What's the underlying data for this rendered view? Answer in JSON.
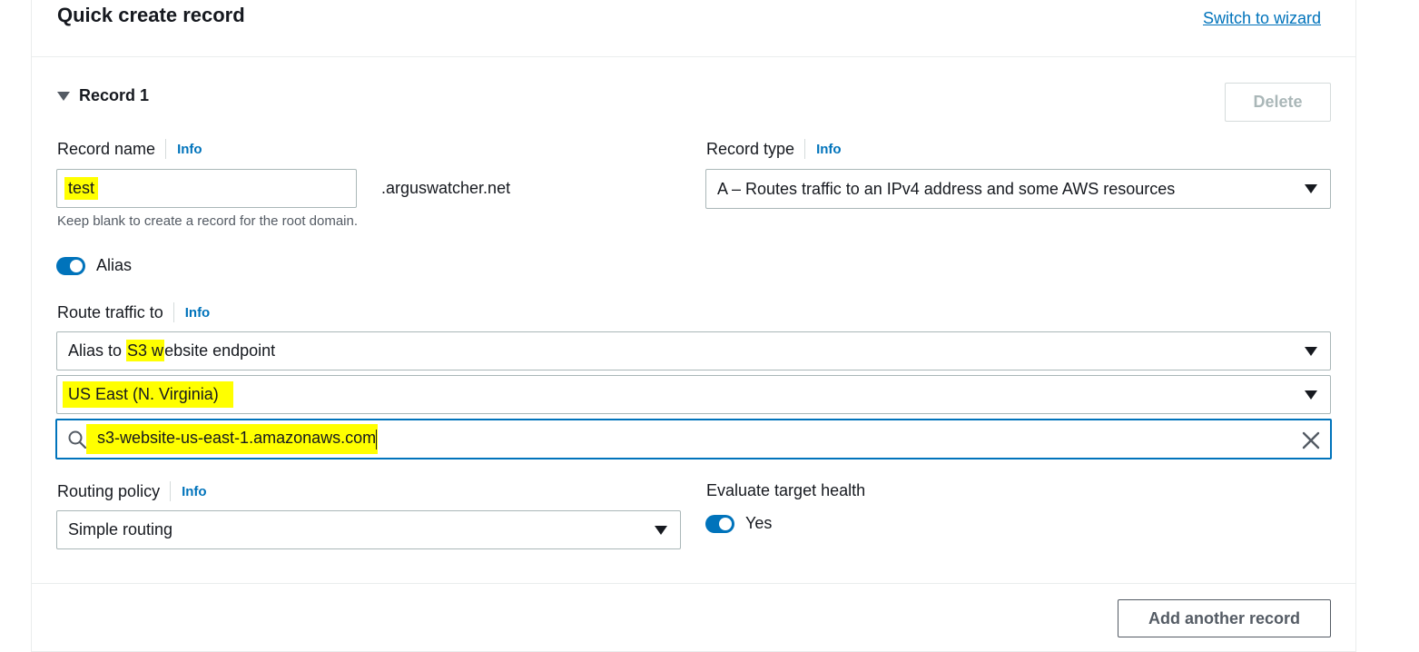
{
  "header": {
    "title": "Quick create record",
    "switch_link": "Switch to wizard"
  },
  "record": {
    "heading": "Record 1",
    "delete_label": "Delete",
    "record_name": {
      "label": "Record name",
      "info": "Info",
      "value": "test",
      "suffix": ".arguswatcher.net",
      "hint": "Keep blank to create a record for the root domain."
    },
    "record_type": {
      "label": "Record type",
      "info": "Info",
      "value": "A – Routes traffic to an IPv4 address and some AWS resources"
    },
    "alias": {
      "label": "Alias",
      "on": true
    },
    "route_traffic": {
      "label": "Route traffic to",
      "info": "Info",
      "endpoint_prefix": "Alias to ",
      "endpoint_highlight": "S3 w",
      "endpoint_suffix": "ebsite endpoint",
      "region": "US East (N. Virginia)",
      "search_value": "s3-website-us-east-1.amazonaws.com"
    },
    "routing_policy": {
      "label": "Routing policy",
      "info": "Info",
      "value": "Simple routing"
    },
    "evaluate_health": {
      "label": "Evaluate target health",
      "toggle_label": "Yes",
      "on": true
    }
  },
  "footer": {
    "add_label": "Add another record"
  },
  "colors": {
    "accent": "#0073bb",
    "highlight": "#ffff00"
  }
}
